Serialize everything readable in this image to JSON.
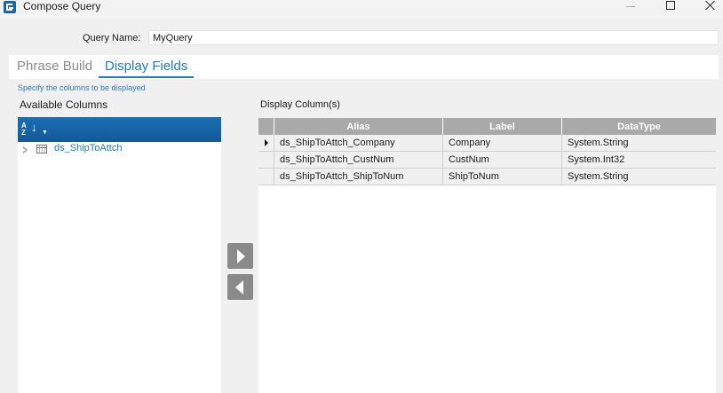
{
  "window": {
    "title": "Compose Query"
  },
  "query_name": {
    "label": "Query Name:",
    "value": "MyQuery"
  },
  "tabs": [
    {
      "label": "Phrase Build",
      "active": false
    },
    {
      "label": "Display Fields",
      "active": true
    }
  ],
  "hint": "Specify the columns to be displayed",
  "available": {
    "title": "Available Columns",
    "sort_icon": "sort-az-icon",
    "items": [
      {
        "label": "ds_ShipToAttch",
        "icon": "table-icon"
      }
    ]
  },
  "display": {
    "title": "Display Column(s)",
    "columns": [
      "Alias",
      "Label",
      "DataType"
    ],
    "rows": [
      {
        "alias": "ds_ShipToAttch_Company",
        "label": "Company",
        "datatype": "System.String",
        "current": true
      },
      {
        "alias": "ds_ShipToAttch_CustNum",
        "label": "CustNum",
        "datatype": "System.Int32",
        "current": false
      },
      {
        "alias": "ds_ShipToAttch_ShipToNum",
        "label": "ShipToNum",
        "datatype": "System.String",
        "current": false
      }
    ]
  },
  "colors": {
    "accent": "#1e7bc4",
    "header_blue": "#1a6fb5",
    "grid_header": "#a9a9a9"
  }
}
